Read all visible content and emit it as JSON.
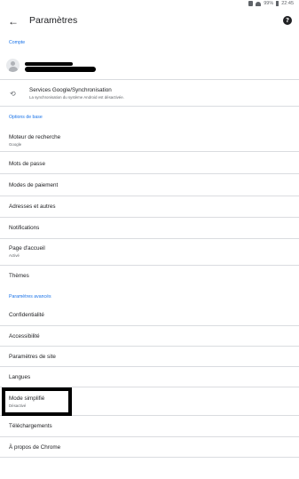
{
  "status_bar": {
    "battery": "99%",
    "time": "22:45"
  },
  "toolbar": {
    "title": "Paramètres"
  },
  "sections": {
    "account": "Compte",
    "basics": "Options de base",
    "advanced": "Paramètres avancés"
  },
  "sync": {
    "title": "Services Google/Synchronisation",
    "subtitle": "La synchronisation du système Android est désactivée."
  },
  "items": {
    "search_engine": {
      "title": "Moteur de recherche",
      "subtitle": "Google"
    },
    "passwords": {
      "title": "Mots de passe"
    },
    "payment": {
      "title": "Modes de paiement"
    },
    "addresses": {
      "title": "Adresses et autres"
    },
    "notifications": {
      "title": "Notifications"
    },
    "homepage": {
      "title": "Page d'accueil",
      "subtitle": "Activé"
    },
    "themes": {
      "title": "Thèmes"
    },
    "privacy": {
      "title": "Confidentialité"
    },
    "accessibility": {
      "title": "Accessibilité"
    },
    "site_settings": {
      "title": "Paramètres de site"
    },
    "languages": {
      "title": "Langues"
    },
    "lite_mode": {
      "title": "Mode simplifié",
      "subtitle": "Désactivé"
    },
    "downloads": {
      "title": "Téléchargements"
    },
    "about": {
      "title": "À propos de Chrome"
    }
  }
}
